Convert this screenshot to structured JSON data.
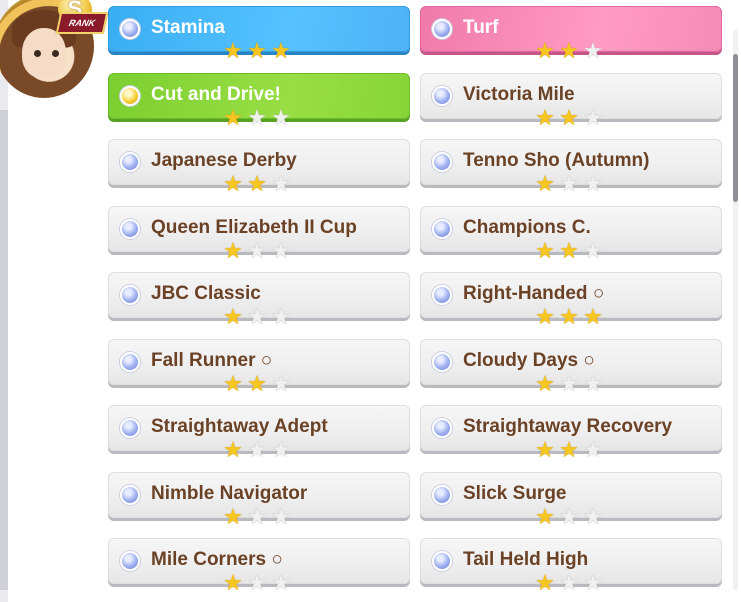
{
  "profile": {
    "rank_label": "RANK",
    "rank_letter": "S"
  },
  "skills": [
    {
      "label": "Stamina",
      "stars": 3,
      "color": "blue",
      "icon": "blue-orb-icon"
    },
    {
      "label": "Turf",
      "stars": 2,
      "color": "pink",
      "icon": "blue-orb-icon"
    },
    {
      "label": "Cut and Drive!",
      "stars": 1,
      "color": "green",
      "icon": "gold-orb-icon"
    },
    {
      "label": "Victoria Mile",
      "stars": 2,
      "color": "gray",
      "icon": "blue-orb-icon"
    },
    {
      "label": "Japanese Derby",
      "stars": 2,
      "color": "gray",
      "icon": "blue-orb-icon"
    },
    {
      "label": "Tenno Sho (Autumn)",
      "stars": 1,
      "color": "gray",
      "icon": "blue-orb-icon"
    },
    {
      "label": "Queen Elizabeth II Cup",
      "stars": 1,
      "color": "gray",
      "icon": "blue-orb-icon"
    },
    {
      "label": "Champions C.",
      "stars": 2,
      "color": "gray",
      "icon": "blue-orb-icon"
    },
    {
      "label": "JBC Classic",
      "stars": 1,
      "color": "gray",
      "icon": "blue-orb-icon"
    },
    {
      "label": "Right-Handed ○",
      "stars": 3,
      "color": "gray",
      "icon": "blue-orb-icon"
    },
    {
      "label": "Fall Runner ○",
      "stars": 2,
      "color": "gray",
      "icon": "blue-orb-icon"
    },
    {
      "label": "Cloudy Days ○",
      "stars": 1,
      "color": "gray",
      "icon": "blue-orb-icon"
    },
    {
      "label": "Straightaway Adept",
      "stars": 1,
      "color": "gray",
      "icon": "blue-orb-icon"
    },
    {
      "label": "Straightaway Recovery",
      "stars": 2,
      "color": "gray",
      "icon": "blue-orb-icon"
    },
    {
      "label": "Nimble Navigator",
      "stars": 1,
      "color": "gray",
      "icon": "blue-orb-icon"
    },
    {
      "label": "Slick Surge",
      "stars": 1,
      "color": "gray",
      "icon": "blue-orb-icon"
    },
    {
      "label": "Mile Corners ○",
      "stars": 1,
      "color": "gray",
      "icon": "blue-orb-icon"
    },
    {
      "label": "Tail Held High",
      "stars": 1,
      "color": "gray",
      "icon": "blue-orb-icon"
    }
  ],
  "colors": {
    "blue": "#3aaef3",
    "pink": "#f07aaa",
    "green": "#7ccf30",
    "label_brown": "#6b4226",
    "star_gold": "#f6c51f"
  }
}
